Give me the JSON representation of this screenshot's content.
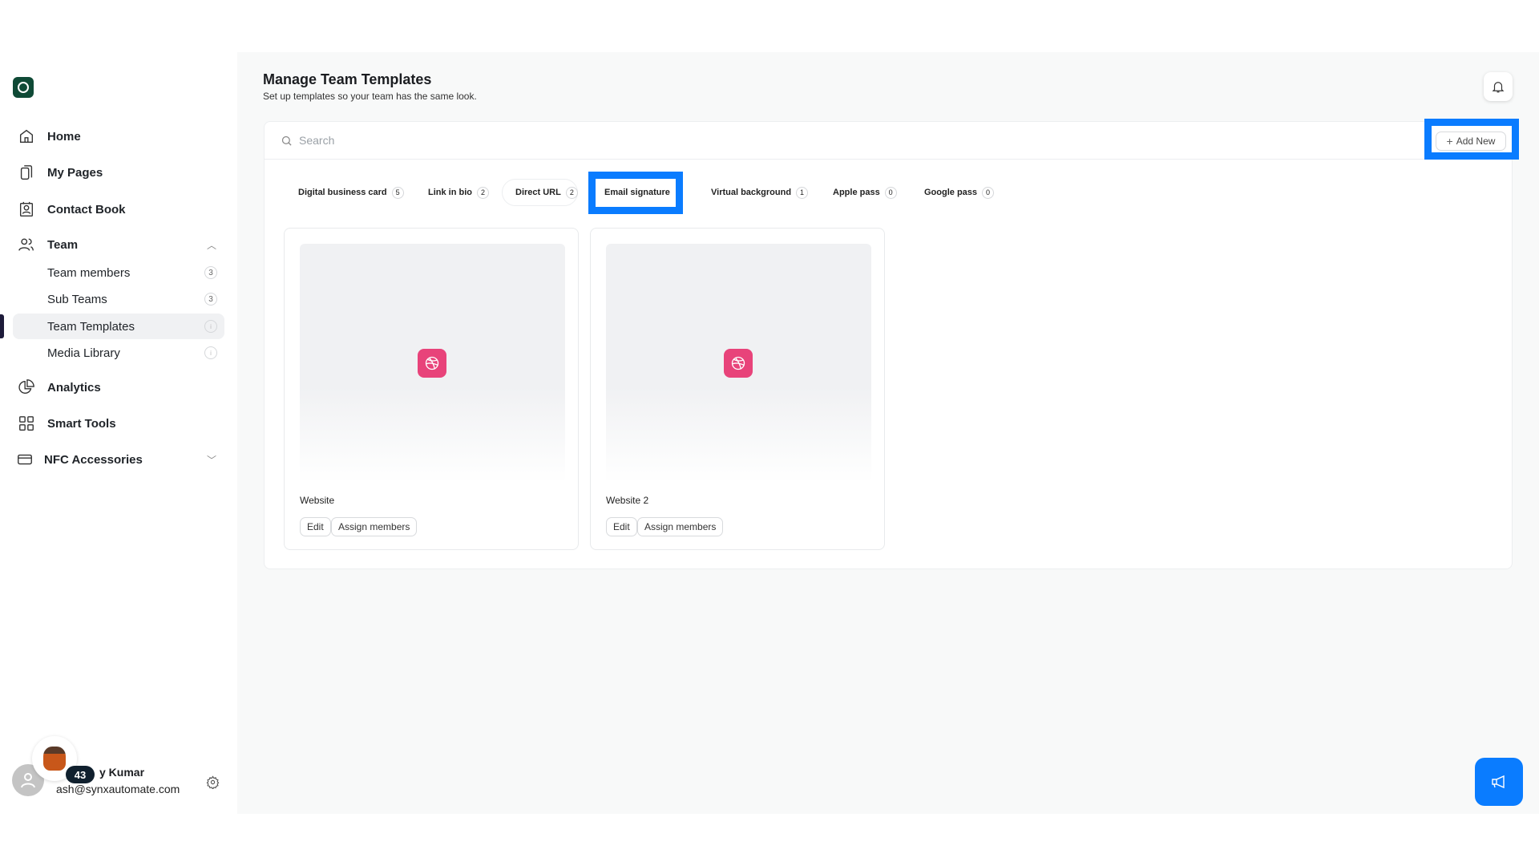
{
  "sidebar": {
    "items": [
      {
        "label": "Home",
        "icon": "home-icon"
      },
      {
        "label": "My Pages",
        "icon": "pages-icon"
      },
      {
        "label": "Contact Book",
        "icon": "contact-book-icon"
      },
      {
        "label": "Team",
        "icon": "team-icon"
      },
      {
        "label": "Team members",
        "count": "3"
      },
      {
        "label": "Sub Teams",
        "count": "3"
      },
      {
        "label": "Team Templates",
        "active": true
      },
      {
        "label": "Media Library"
      },
      {
        "label": "Analytics",
        "icon": "analytics-icon"
      },
      {
        "label": "Smart Tools",
        "icon": "grid-icon"
      },
      {
        "label": "NFC Accessories",
        "icon": "card-icon"
      }
    ],
    "user": {
      "badge": "43",
      "name": "y Kumar",
      "email": "ash@synxautomate.com"
    }
  },
  "header": {
    "title": "Manage Team Templates",
    "subtitle": "Set up templates so your team has the same look."
  },
  "search": {
    "placeholder": "Search"
  },
  "add_new_label": "Add New",
  "tabs": [
    {
      "label": "Digital business card",
      "count": "5"
    },
    {
      "label": "Link in bio",
      "count": "2"
    },
    {
      "label": "Direct URL",
      "count": "2"
    },
    {
      "label": "Email signature"
    },
    {
      "label": "Virtual background",
      "count": "1"
    },
    {
      "label": "Apple pass",
      "count": "0"
    },
    {
      "label": "Google pass",
      "count": "0"
    }
  ],
  "cards": [
    {
      "name": "Website",
      "edit": "Edit",
      "assign": "Assign members"
    },
    {
      "name": "Website 2",
      "edit": "Edit",
      "assign": "Assign members"
    }
  ],
  "colors": {
    "accent": "#0a7cff",
    "pink": "#e8437a",
    "brand": "#0f4a36"
  }
}
